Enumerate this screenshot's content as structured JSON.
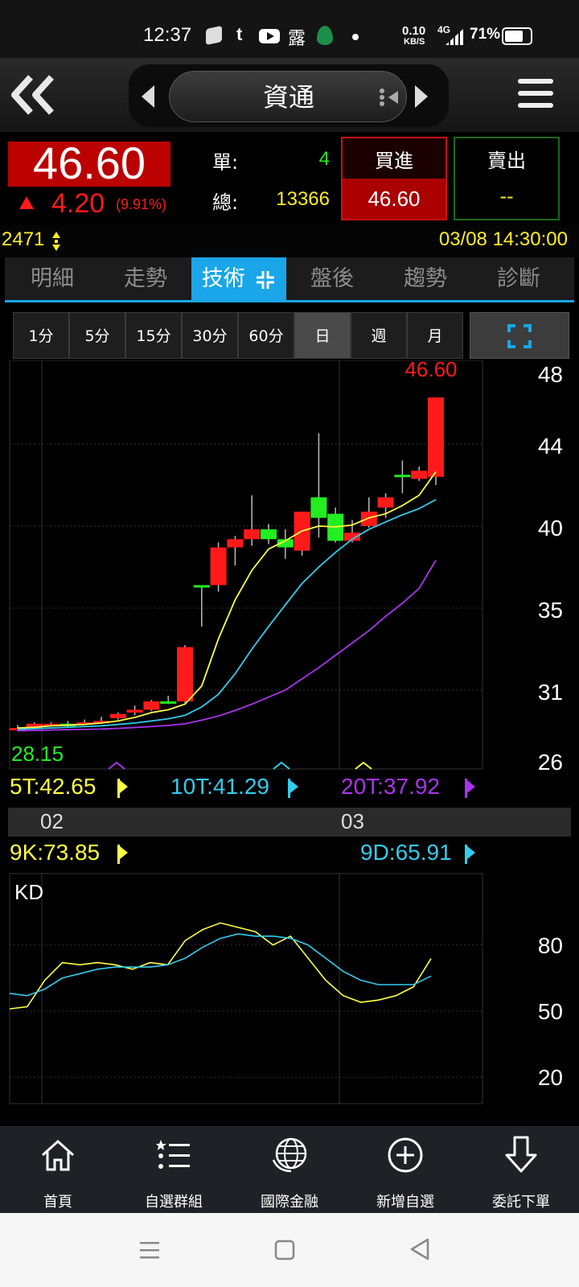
{
  "status_bar": {
    "time": "12:37",
    "net_speed": "0.10",
    "net_unit": "KB/S",
    "signal": "4G",
    "battery": "71%",
    "notif_char": "露"
  },
  "header": {
    "stock_name": "資通"
  },
  "quote": {
    "price": "46.60",
    "change": "4.20",
    "change_pct": "(9.91%)",
    "unit_label": "單:",
    "unit_value": "4",
    "total_label": "總:",
    "total_value": "13366",
    "buy_label": "買進",
    "buy_price": "46.60",
    "sell_label": "賣出",
    "sell_price": "--"
  },
  "info": {
    "code": "2471",
    "datetime": "03/08 14:30:00"
  },
  "tabs": [
    "明細",
    "走勢",
    "技術",
    "盤後",
    "趨勢",
    "診斷"
  ],
  "active_tab": 2,
  "periods": [
    "1分",
    "5分",
    "15分",
    "30分",
    "60分",
    "日",
    "週",
    "月"
  ],
  "selected_period": 5,
  "ma": {
    "ma5": "5T:42.65",
    "ma10": "10T:41.29",
    "ma20": "20T:37.92"
  },
  "date_axis": [
    "02",
    "03"
  ],
  "kd": {
    "k": "9K:73.85",
    "d": "9D:65.91",
    "title": "KD"
  },
  "nav": [
    "首頁",
    "自選群組",
    "國際金融",
    "新增自選",
    "委託下單"
  ],
  "colors": {
    "up": "#ff1a1a",
    "down": "#22ee22",
    "ma5": "#ffff44",
    "ma10": "#33ccee",
    "ma20": "#aa33ee",
    "accent": "#1aa6e8"
  },
  "chart_data": [
    {
      "type": "candlestick",
      "title": "",
      "ylim": [
        26,
        48
      ],
      "yticks": [
        "48",
        "44",
        "40",
        "35",
        "31",
        "26"
      ],
      "last_label": "46.60",
      "low_label": "28.15",
      "candles": [
        {
          "o": 28.3,
          "h": 28.5,
          "l": 28.1,
          "c": 28.3
        },
        {
          "o": 28.3,
          "h": 28.7,
          "l": 28.2,
          "c": 28.6
        },
        {
          "o": 28.6,
          "h": 28.7,
          "l": 28.4,
          "c": 28.6
        },
        {
          "o": 28.6,
          "h": 28.8,
          "l": 28.4,
          "c": 28.6
        },
        {
          "o": 28.6,
          "h": 28.9,
          "l": 28.5,
          "c": 28.7
        },
        {
          "o": 28.7,
          "h": 29.1,
          "l": 28.6,
          "c": 28.8
        },
        {
          "o": 29.0,
          "h": 29.4,
          "l": 28.9,
          "c": 29.3
        },
        {
          "o": 29.4,
          "h": 29.9,
          "l": 29.2,
          "c": 29.6
        },
        {
          "o": 29.6,
          "h": 30.3,
          "l": 29.5,
          "c": 30.2
        },
        {
          "o": 30.2,
          "h": 30.6,
          "l": 30.0,
          "c": 30.2
        },
        {
          "o": 30.2,
          "h": 33.2,
          "l": 30.1,
          "c": 33.1
        },
        {
          "o": 36.4,
          "h": 36.4,
          "l": 34.1,
          "c": 36.4
        },
        {
          "o": 36.4,
          "h": 39.0,
          "l": 36.0,
          "c": 38.7
        },
        {
          "o": 38.7,
          "h": 39.4,
          "l": 37.6,
          "c": 39.2
        },
        {
          "o": 39.2,
          "h": 41.5,
          "l": 38.8,
          "c": 39.8
        },
        {
          "o": 39.8,
          "h": 40.1,
          "l": 38.9,
          "c": 39.2
        },
        {
          "o": 39.2,
          "h": 39.8,
          "l": 38.0,
          "c": 38.7
        },
        {
          "o": 38.5,
          "h": 40.7,
          "l": 38.2,
          "c": 40.7
        },
        {
          "o": 41.4,
          "h": 44.6,
          "l": 39.3,
          "c": 40.4
        },
        {
          "o": 40.6,
          "h": 40.9,
          "l": 39.0,
          "c": 39.1
        },
        {
          "o": 39.1,
          "h": 40.3,
          "l": 39.0,
          "c": 39.6
        },
        {
          "o": 40.0,
          "h": 41.4,
          "l": 39.9,
          "c": 40.7
        },
        {
          "o": 40.9,
          "h": 41.6,
          "l": 40.4,
          "c": 41.4
        },
        {
          "o": 42.5,
          "h": 43.2,
          "l": 41.6,
          "c": 42.4
        },
        {
          "o": 42.3,
          "h": 42.9,
          "l": 42.2,
          "c": 42.7
        },
        {
          "o": 42.4,
          "h": 46.6,
          "l": 42.0,
          "c": 46.6
        }
      ],
      "series": [
        {
          "name": "5T",
          "values": [
            28.3,
            28.35,
            28.45,
            28.5,
            28.55,
            28.65,
            28.8,
            29.05,
            29.4,
            29.6,
            30.0,
            31.2,
            33.5,
            35.5,
            37.3,
            38.6,
            39.1,
            39.7,
            40.0,
            39.95,
            40.05,
            40.4,
            40.6,
            41.0,
            41.5,
            42.65
          ]
        },
        {
          "name": "10T",
          "values": [
            28.2,
            28.25,
            28.3,
            28.35,
            28.4,
            28.45,
            28.55,
            28.65,
            28.8,
            28.95,
            29.2,
            29.8,
            30.7,
            31.8,
            33.0,
            34.1,
            35.2,
            36.5,
            37.5,
            38.4,
            39.2,
            39.8,
            40.2,
            40.55,
            40.85,
            41.29
          ]
        },
        {
          "name": "20T",
          "values": [
            28.1,
            28.12,
            28.15,
            28.18,
            28.2,
            28.22,
            28.27,
            28.33,
            28.4,
            28.48,
            28.6,
            28.85,
            29.15,
            29.55,
            30.0,
            30.5,
            31.0,
            31.55,
            32.1,
            32.7,
            33.3,
            33.9,
            34.6,
            35.3,
            36.2,
            37.92
          ]
        }
      ]
    },
    {
      "type": "line",
      "title": "KD",
      "ylim": [
        0,
        100
      ],
      "yticks": [
        "80",
        "50",
        "20"
      ],
      "series": [
        {
          "name": "9K",
          "values": [
            51,
            52,
            64,
            72,
            71,
            72,
            71,
            69,
            72,
            71,
            82,
            87,
            90,
            88,
            86,
            80,
            84,
            74,
            64,
            57,
            54,
            55,
            57,
            61,
            73.85
          ]
        },
        {
          "name": "9D",
          "values": [
            58,
            57,
            60,
            65,
            67,
            69,
            70,
            70,
            70,
            71,
            74,
            79,
            83,
            85,
            84,
            84,
            83,
            80,
            74,
            68,
            64,
            62,
            62,
            62,
            65.91
          ]
        }
      ]
    }
  ]
}
